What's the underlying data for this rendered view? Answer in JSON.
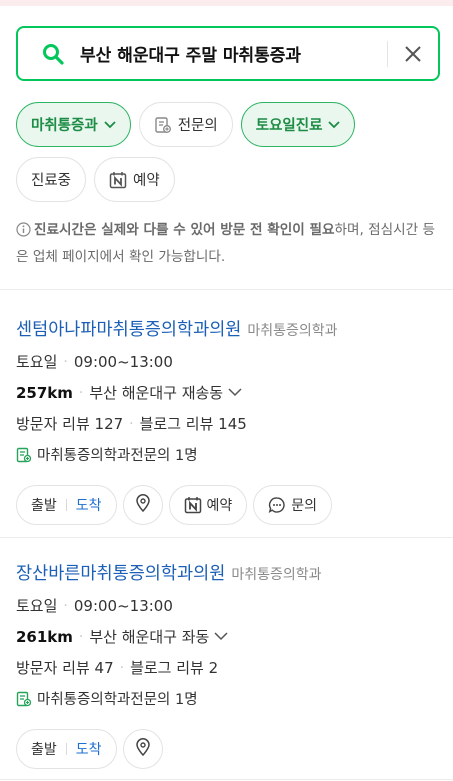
{
  "search": {
    "value": "부산 해운대구 주말 마취통증과",
    "search_icon": "search-icon",
    "clear_icon": "close-icon"
  },
  "filters": {
    "specialty": "마취통증과",
    "specialist": "전문의",
    "saturday": "토요일진료",
    "open_now": "진료중",
    "reservation": "예약"
  },
  "notice": {
    "bold": "진료시간은 실제와 다를 수 있어 방문 전 확인이 필요",
    "rest": "하며, 점심시간 등은 업체 페이지에서 확인 가능합니다."
  },
  "results": [
    {
      "name": "센텀아나파마취통증의학과의원",
      "category": "마취통증의학과",
      "day": "토요일",
      "hours": "09:00~13:00",
      "distance": "257km",
      "address": "부산 해운대구 재송동",
      "visitor_reviews": "방문자 리뷰 127",
      "blog_reviews": "블로그 리뷰 145",
      "specialist": "마취통증의학과전문의 1명",
      "depart": "출발",
      "arrive": "도착",
      "reserve": "예약",
      "inquire": "문의"
    },
    {
      "name": "장산바른마취통증의학과의원",
      "category": "마취통증의학과",
      "day": "토요일",
      "hours": "09:00~13:00",
      "distance": "261km",
      "address": "부산 해운대구 좌동",
      "visitor_reviews": "방문자 리뷰 47",
      "blog_reviews": "블로그 리뷰 2",
      "specialist": "마취통증의학과전문의 1명",
      "depart": "출발",
      "arrive": "도착"
    }
  ],
  "colors": {
    "brand_green": "#03c75a",
    "link_blue": "#1b5fb6"
  }
}
